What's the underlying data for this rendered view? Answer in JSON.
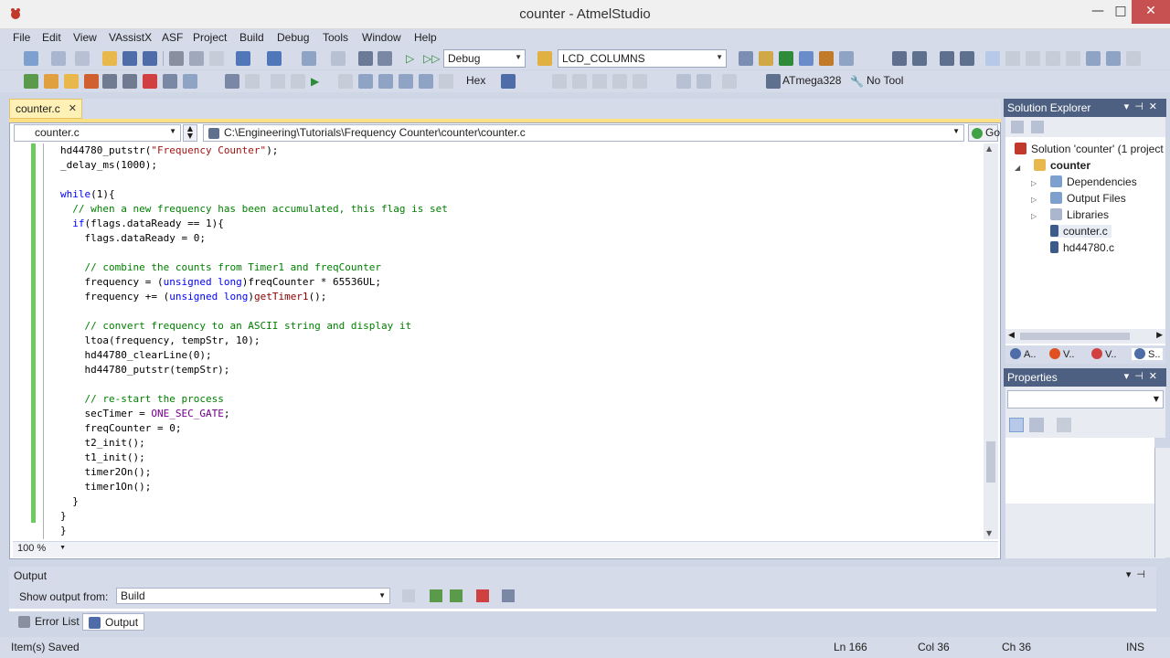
{
  "window": {
    "title": "counter - AtmelStudio",
    "minimize": "—",
    "maximize": "□",
    "close": "✕"
  },
  "menu": [
    "File",
    "Edit",
    "View",
    "VAssistX",
    "ASF",
    "Project",
    "Build",
    "Debug",
    "Tools",
    "Window",
    "Help"
  ],
  "toolbar": {
    "config": "Debug",
    "find": "LCD_COLUMNS",
    "hex": "Hex",
    "device": "ATmega328",
    "tool": "No Tool"
  },
  "editor": {
    "tab_label": "counter.c",
    "nav_file": "counter.c",
    "nav_path": "C:\\Engineering\\Tutorials\\Frequency Counter\\counter\\counter.c",
    "go_label": "Go",
    "zoom": "100 %",
    "code": [
      "hd44780_putstr(\"Frequency Counter\");",
      "_delay_ms(1000);",
      "",
      "while(1){",
      "  // when a new frequency has been accumulated, this flag is set",
      "  if(flags.dataReady == 1){",
      "    flags.dataReady = 0;",
      "",
      "    // combine the counts from Timer1 and freqCounter",
      "    frequency = (unsigned long)freqCounter * 65536UL;",
      "    frequency += (unsigned long)getTimer1();",
      "",
      "    // convert frequency to an ASCII string and display it",
      "    ltoa(frequency, tempStr, 10);",
      "    hd44780_clearLine(0);",
      "    hd44780_putstr(tempStr);",
      "",
      "    // re-start the process",
      "    secTimer = ONE_SEC_GATE;",
      "    freqCounter = 0;",
      "    t2_init();",
      "    t1_init();",
      "    timer2On();",
      "    timer1On();",
      "  }",
      "}",
      "}"
    ]
  },
  "solution_explorer": {
    "title": "Solution Explorer",
    "solution": "Solution 'counter' (1 project",
    "project": "counter",
    "items": [
      "Dependencies",
      "Output Files",
      "Libraries",
      "counter.c",
      "hd44780.c"
    ],
    "tabs": [
      "A..",
      "V..",
      "V..",
      "S.."
    ]
  },
  "properties": {
    "title": "Properties"
  },
  "output": {
    "title": "Output",
    "show_from_label": "Show output from:",
    "source": "Build"
  },
  "bottom_tabs": [
    "Error List",
    "Output"
  ],
  "status": {
    "message": "Item(s) Saved",
    "ln": "Ln 166",
    "col": "Col 36",
    "ch": "Ch 36",
    "mode": "INS"
  }
}
